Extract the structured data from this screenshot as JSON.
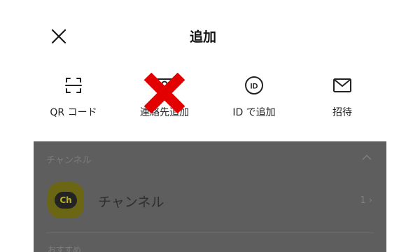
{
  "header": {
    "title": "追加",
    "close_icon": "close-icon"
  },
  "actions": [
    {
      "label": "QR コード",
      "icon": "qr-scan-icon"
    },
    {
      "label": "連絡先追加",
      "icon": "contact-card-icon"
    },
    {
      "label": "ID で追加",
      "icon": "id-icon"
    },
    {
      "label": "招待",
      "icon": "envelope-icon"
    }
  ],
  "annotation": {
    "icon": "red-x-mark",
    "color": "#e30000"
  },
  "overlay": {
    "color": "#5e5e5e",
    "section_title": "チャンネル",
    "channel_row": {
      "badge": "Ch",
      "label": "チャンネル",
      "count": "1"
    },
    "next_section": "おすすめ"
  }
}
